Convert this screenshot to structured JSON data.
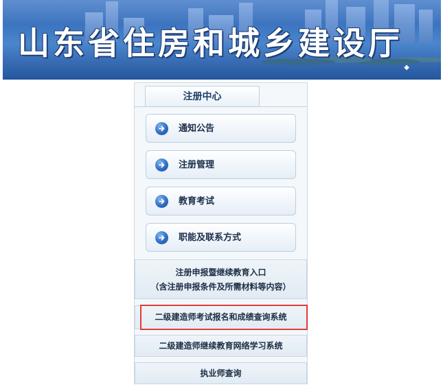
{
  "banner": {
    "title": "山东省住房和城乡建设厅"
  },
  "sidebar": {
    "tab_label": "注册中心",
    "menu": [
      {
        "label": "通知公告",
        "icon": "arrow-right-circle-icon"
      },
      {
        "label": "注册管理",
        "icon": "arrow-right-circle-icon"
      },
      {
        "label": "教育考试",
        "icon": "arrow-right-circle-icon"
      },
      {
        "label": "职能及联系方式",
        "icon": "arrow-right-circle-icon"
      }
    ],
    "links": {
      "registration_entry": {
        "line1": "注册申报暨继续教育入口",
        "line2": "（含注册申报条件及所需材料等内容）"
      },
      "exam_system": "二级建造师考试报名和成绩查询系统",
      "online_learning": "二级建造师继续教育网络学习系统",
      "practitioner_query": "执业师查询"
    }
  },
  "colors": {
    "highlight_border": "#e23a3a",
    "banner_blue": "#3e77c2",
    "icon_blue": "#2e6fc2"
  }
}
